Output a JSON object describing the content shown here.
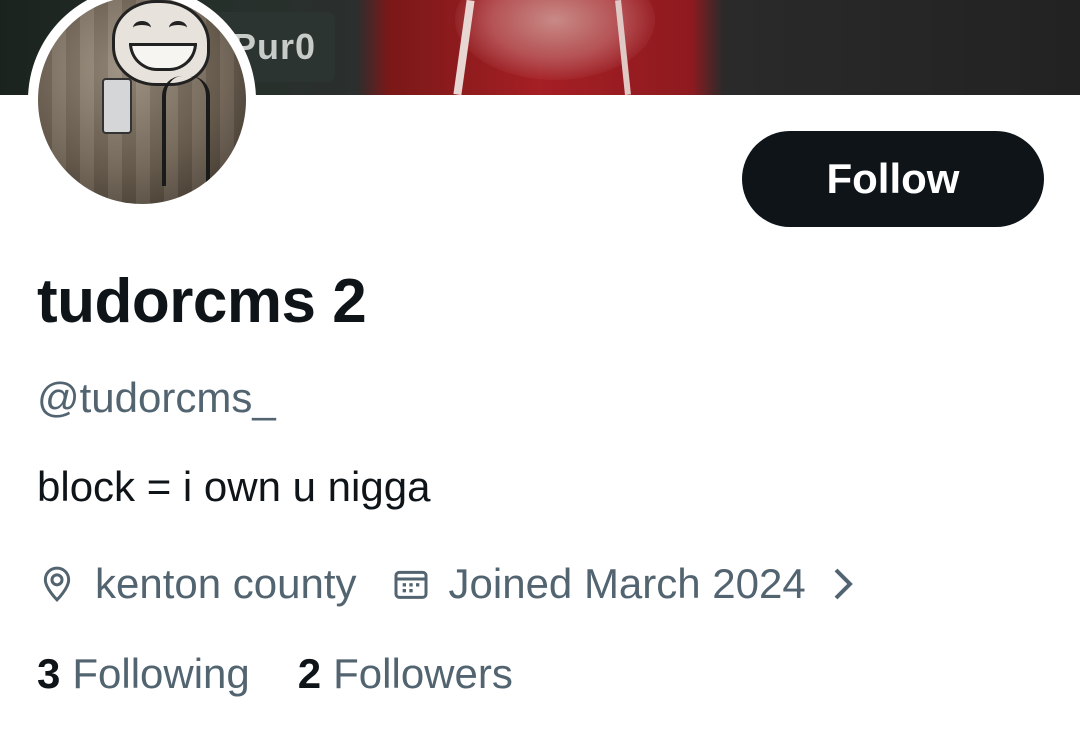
{
  "banner": {
    "overlay_text": "Pur0"
  },
  "profile": {
    "display_name": "tudorcms 2",
    "handle": "@tudorcms_",
    "bio": "block = i own u nigga",
    "location": "kenton county",
    "joined": "Joined March 2024",
    "follow_label": "Follow"
  },
  "stats": {
    "following_count": "3",
    "following_label": "Following",
    "followers_count": "2",
    "followers_label": "Followers"
  },
  "icons": {
    "location": "location-pin-icon",
    "calendar": "calendar-icon",
    "chevron": "chevron-right-icon"
  },
  "colors": {
    "primary_text": "#0f1419",
    "secondary_text": "#536471",
    "button_bg": "#0f1419",
    "button_text": "#ffffff"
  }
}
